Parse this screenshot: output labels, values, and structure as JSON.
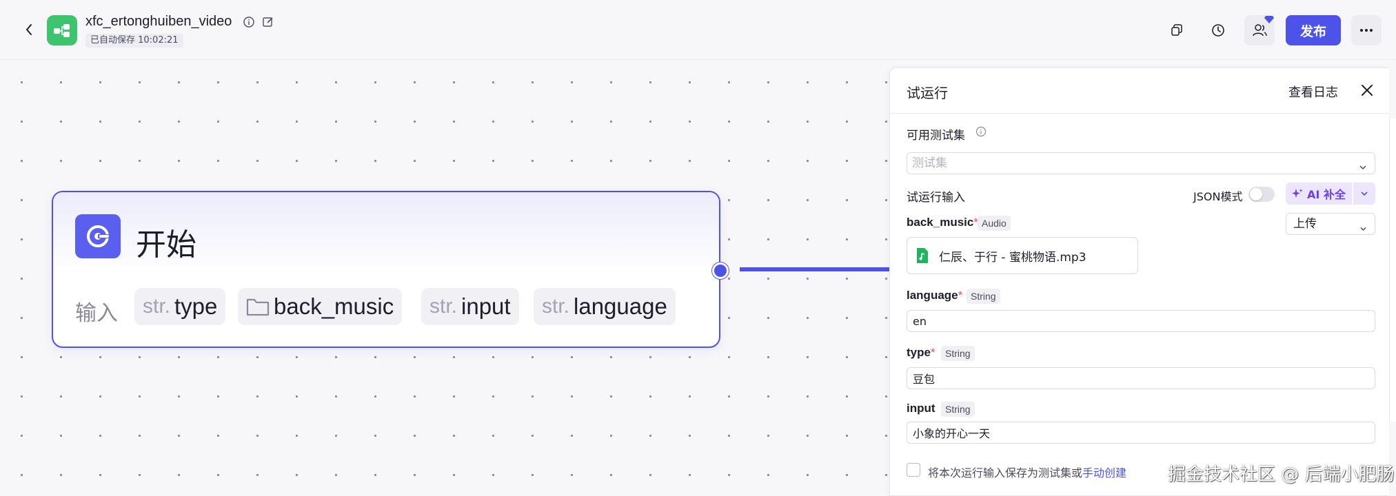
{
  "header": {
    "title": "xfc_ertonghuiben_video",
    "autosave": "已自动保存 10:02:21",
    "publish_label": "发布"
  },
  "node": {
    "title": "开始",
    "input_label": "输入",
    "params": [
      {
        "prefix": "str.",
        "name": "type"
      },
      {
        "prefix": "",
        "name": "back_music",
        "icon": "folder-icon"
      },
      {
        "prefix": "str.",
        "name": "input"
      },
      {
        "prefix": "str.",
        "name": "language"
      }
    ]
  },
  "panel": {
    "title": "试运行",
    "view_log": "查看日志",
    "testset_label": "可用测试集",
    "testset_placeholder": "测试集",
    "run_input_label": "试运行输入",
    "json_mode_label": "JSON模式",
    "json_mode_on": false,
    "ai_fill_label": "AI 补全",
    "fields": {
      "back_music": {
        "label": "back_music",
        "type": "Audio",
        "upload_mode": "上传",
        "file_name": "仁辰、于行 - 蜜桃物语.mp3"
      },
      "language": {
        "label": "language",
        "type": "String",
        "value": "en"
      },
      "type": {
        "label": "type",
        "type": "String",
        "value": "豆包"
      },
      "input": {
        "label": "input",
        "type": "String",
        "value": "小象的开心一天"
      }
    },
    "save_text": "将本次运行输入保存为测试集或",
    "save_link": "手动创建"
  },
  "watermark": "掘金技术社区 @ 后端小肥肠",
  "colors": {
    "accent": "#4d53e8",
    "logo_green": "#3ec46d",
    "required": "#f04b4b",
    "ai_purple": "#6b3ff0"
  }
}
